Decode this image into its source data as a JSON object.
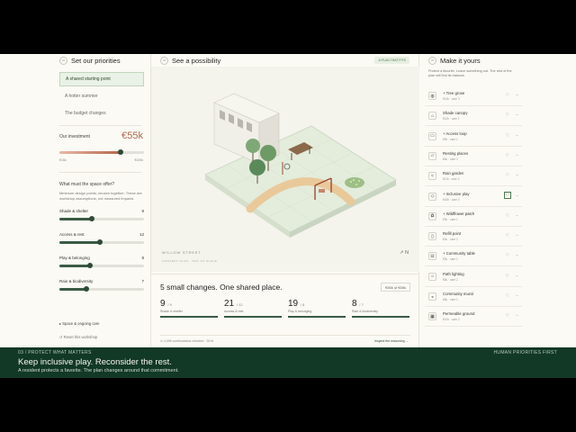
{
  "left": {
    "num": "01",
    "title": "Set our priorities",
    "tabs": [
      "A shared starting point",
      "A hotter summer",
      "The budget changes"
    ],
    "investment": {
      "label": "Our investment",
      "value": "€55k",
      "level": 0.72,
      "min": "€15k",
      "max": "€100k"
    },
    "question": "What must the space offer?",
    "note": "Minimum design points, chosen together. These are workshop assumptions, not measured impacts.",
    "sliders": [
      {
        "label": "Shade & shelter",
        "value": "9",
        "level": 0.38
      },
      {
        "label": "Access & rest",
        "value": "12",
        "level": 0.48
      },
      {
        "label": "Play & belonging",
        "value": "8",
        "level": 0.36
      },
      {
        "label": "Rain & biodiversity",
        "value": "7",
        "level": 0.32
      }
    ],
    "space_care": "▸ Space & ongoing care",
    "reset": "↺ Reset this workshop"
  },
  "middle": {
    "num": "02",
    "title": "See a possibility",
    "badge": "A PLAN THAT FITS",
    "street": "WILLOW STREET",
    "street_sub": "CONCEPT PLAN · NOT TO SCALE",
    "compass": "↗ N",
    "summary": {
      "title": "5 small changes. One shared place.",
      "price": "€55k of €55k",
      "stats": [
        {
          "num": "9",
          "of": "/ 9",
          "label": "Shade & shelter",
          "level": 1.0
        },
        {
          "num": "21",
          "of": "/ 12",
          "label": "Access & rest",
          "level": 1.0
        },
        {
          "num": "19",
          "of": "/ 8",
          "label": "Play & belonging",
          "level": 1.0
        },
        {
          "num": "8",
          "of": "/ 7",
          "label": "Rain & biodiversity",
          "level": 1.0
        }
      ],
      "footnote": "⊙ 4,096 combinations checked · 26 fit",
      "inspect": "Inspect the reasoning →"
    }
  },
  "right": {
    "num": "03",
    "title": "Make it yours",
    "note": "Protect a favorite. Leave something out. The rest of the plan will find its balance.",
    "items": [
      {
        "icon": "◍",
        "name": "+ Tree grove",
        "meta": "€14k · care 3",
        "protected": false
      },
      {
        "icon": "⌂",
        "name": "Shade canopy",
        "meta": "€12k · care 1",
        "protected": false
      },
      {
        "icon": "▭",
        "name": "+ Access loop",
        "meta": "€9k · care 1",
        "protected": false
      },
      {
        "icon": "▱",
        "name": "Resting places",
        "meta": "€6k · care 2",
        "protected": false
      },
      {
        "icon": "≈",
        "name": "Rain garden",
        "meta": "€11k · care 3",
        "protected": false
      },
      {
        "icon": "◇",
        "name": "+ Inclusive play",
        "meta": "€16k · care 3",
        "protected": true
      },
      {
        "icon": "✿",
        "name": "+ Wildflower patch",
        "meta": "€3k · care 1",
        "protected": false
      },
      {
        "icon": "▯",
        "name": "Refill point",
        "meta": "€4k · care 2",
        "protected": false
      },
      {
        "icon": "⊟",
        "name": "+ Community table",
        "meta": "€3k · care 1",
        "protected": false
      },
      {
        "icon": "☼",
        "name": "Path lighting",
        "meta": "€8k · care 2",
        "protected": false
      },
      {
        "icon": "◒",
        "name": "Community mural",
        "meta": "€5k · care 1",
        "protected": false
      },
      {
        "icon": "▦",
        "name": "Permeable ground",
        "meta": "€10k · care 2",
        "protected": false
      }
    ]
  },
  "caption": {
    "kicker": "03 / PROTECT WHAT MATTERS",
    "title": "Keep inclusive play. Reconsider the rest.",
    "subtitle": "A resident protects a favorite. The plan changes around that commitment.",
    "right": "HUMAN PRIORITIES FIRST"
  },
  "colors": {
    "accent": "#2f4a38",
    "terracotta": "#b4664a",
    "caption_bg": "#123826"
  }
}
